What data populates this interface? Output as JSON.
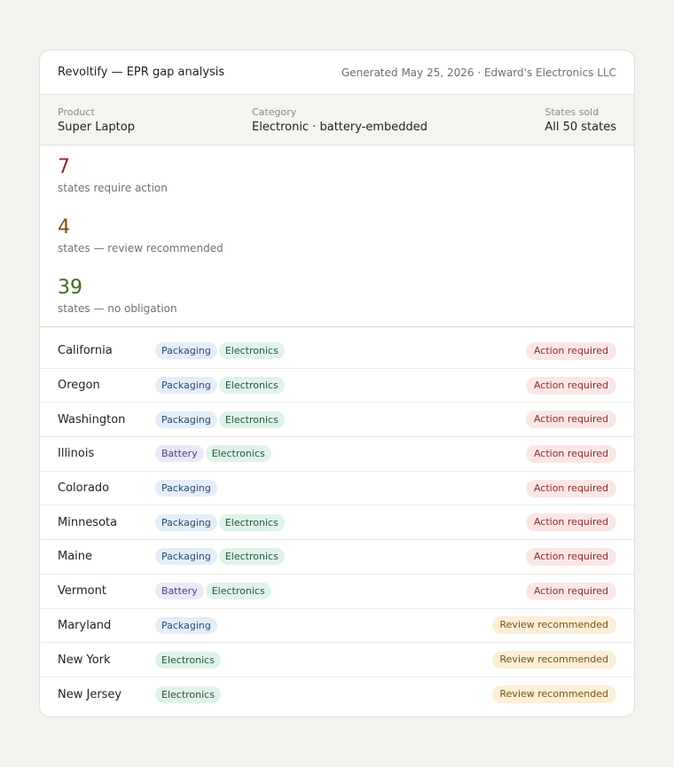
{
  "header": {
    "title": "Revoltify — EPR gap analysis",
    "generated": "Generated May 25, 2026 · Edward's Electronics LLC"
  },
  "meta": {
    "product_label": "Product",
    "product_value": "Super Laptop",
    "category_label": "Category",
    "category_value": "Electronic · battery-embedded",
    "states_label": "States sold",
    "states_value": "All 50 states"
  },
  "summary": {
    "action": {
      "count": "7",
      "desc": "states require action",
      "color": "#8f2b2b"
    },
    "review": {
      "count": "4",
      "desc": "states — review recommended",
      "color": "#7a5212"
    },
    "none": {
      "count": "39",
      "desc": "states — no obligation",
      "color": "#3f6b1e"
    }
  },
  "rows": [
    {
      "state": "California",
      "tags": [
        "Packaging",
        "Electronics"
      ],
      "status": "Action required",
      "kind": "action"
    },
    {
      "state": "Oregon",
      "tags": [
        "Packaging",
        "Electronics"
      ],
      "status": "Action required",
      "kind": "action"
    },
    {
      "state": "Washington",
      "tags": [
        "Packaging",
        "Electronics"
      ],
      "status": "Action required",
      "kind": "action"
    },
    {
      "state": "Illinois",
      "tags": [
        "Battery",
        "Electronics"
      ],
      "status": "Action required",
      "kind": "action"
    },
    {
      "state": "Colorado",
      "tags": [
        "Packaging"
      ],
      "status": "Action required",
      "kind": "action"
    },
    {
      "state": "Minnesota",
      "tags": [
        "Packaging",
        "Electronics"
      ],
      "status": "Action required",
      "kind": "action"
    },
    {
      "state": "Maine",
      "tags": [
        "Packaging",
        "Electronics"
      ],
      "status": "Action required",
      "kind": "action"
    },
    {
      "state": "Vermont",
      "tags": [
        "Battery",
        "Electronics"
      ],
      "status": "Action required",
      "kind": "action"
    },
    {
      "state": "Maryland",
      "tags": [
        "Packaging"
      ],
      "status": "Review recommended",
      "kind": "review"
    },
    {
      "state": "New York",
      "tags": [
        "Electronics"
      ],
      "status": "Review recommended",
      "kind": "review"
    },
    {
      "state": "New Jersey",
      "tags": [
        "Electronics"
      ],
      "status": "Review recommended",
      "kind": "review"
    }
  ]
}
